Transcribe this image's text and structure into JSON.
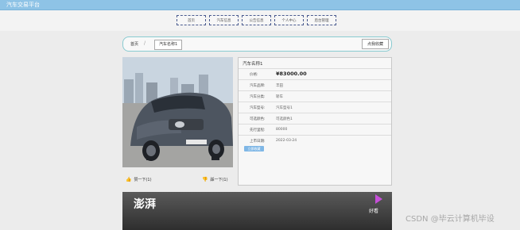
{
  "app": {
    "title": "汽车交易平台"
  },
  "nav": {
    "items": [
      "首页",
      "汽车信息",
      "公告信息",
      "个人中心",
      "后台管理"
    ]
  },
  "breadcrumb": {
    "home": "首页",
    "separator": "/",
    "current": "汽车名称1",
    "action": "点我收藏"
  },
  "car": {
    "name": "汽车名称1",
    "fields": [
      {
        "label": "价格:",
        "value": "¥83000.00"
      },
      {
        "label": "汽车品牌:",
        "value": "丰田"
      },
      {
        "label": "汽车分类:",
        "value": "轿车"
      },
      {
        "label": "汽车型号:",
        "value": "汽车型号1"
      },
      {
        "label": "可选颜色:",
        "value": "可选颜色1"
      },
      {
        "label": "先行里程:",
        "value": "80000"
      },
      {
        "label": "上市日期:",
        "value": "2022-03-24"
      }
    ],
    "collect_label": "立即收藏"
  },
  "votes": {
    "up": "赞一下(1)",
    "down": "踩一下(1)"
  },
  "video": {
    "brand_text": "澎湃",
    "app_label": "好看"
  },
  "watermark": "CSDN @毕云计算机毕设"
}
